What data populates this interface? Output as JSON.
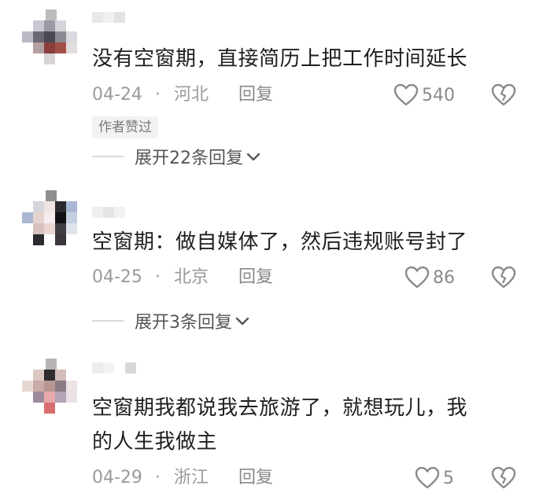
{
  "comments": [
    {
      "text": "没有空窗期，直接简历上把工作时间延长",
      "date": "04-24",
      "separator": "·",
      "location": "河北",
      "reply_label": "回复",
      "likes": "540",
      "badge": "作者赞过",
      "expand_label": "展开22条回复"
    },
    {
      "text": "空窗期：做自媒体了，然后违规账号封了",
      "date": "04-25",
      "separator": "·",
      "location": "北京",
      "reply_label": "回复",
      "likes": "86",
      "expand_label": "展开3条回复"
    },
    {
      "text_line1": "空窗期我都说我去旅游了，就想玩儿，我",
      "text_line2": "的人生我做主",
      "date": "04-29",
      "separator": "·",
      "location": "浙江",
      "reply_label": "回复",
      "likes": "5"
    }
  ],
  "icons": {
    "like": "heart-outline-icon",
    "dislike": "broken-heart-icon",
    "expand": "chevron-down-icon"
  },
  "colors": {
    "text": "#1f1f1f",
    "meta": "#9a9a9a",
    "badge_bg": "#f2f2f2"
  }
}
